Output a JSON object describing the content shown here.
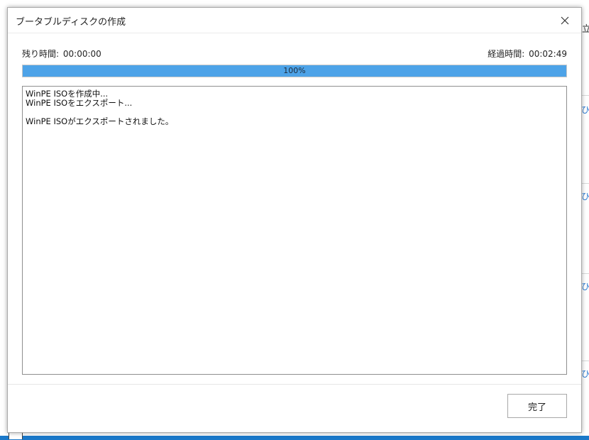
{
  "background": {
    "side_fragments": [
      "ひ",
      "ひ",
      "ひ",
      "ひ"
    ],
    "top_fragment": "立"
  },
  "dialog": {
    "title": "ブータブルディスクの作成",
    "close_icon": "close-icon",
    "remaining_label": "残り時間:",
    "remaining_value": "00:00:00",
    "elapsed_label": "経過時間:",
    "elapsed_value": "00:02:49",
    "progress": {
      "percent": 100,
      "text": "100%",
      "fill_color": "#4da3e8"
    },
    "log_lines": [
      "WinPE ISOを作成中...",
      "WinPE ISOをエクスポート...",
      "",
      "WinPE ISOがエクスポートされました。"
    ],
    "done_button": "完了"
  }
}
